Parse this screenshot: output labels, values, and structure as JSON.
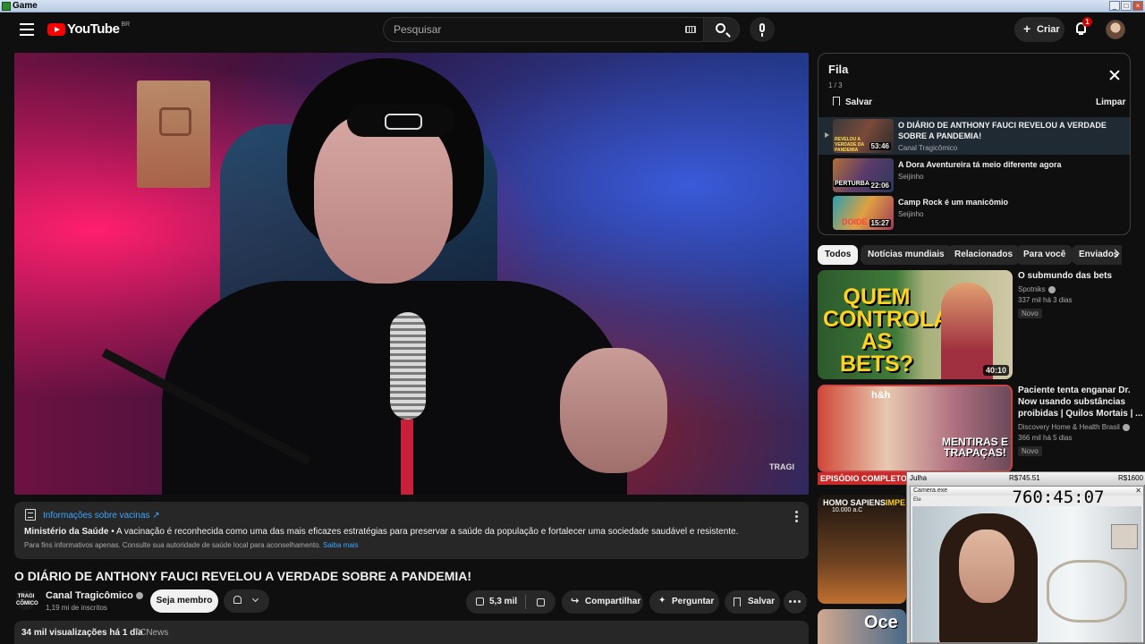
{
  "window": {
    "title": "Game"
  },
  "masthead": {
    "logo_text": "YouTube",
    "region": "BR",
    "search_placeholder": "Pesquisar",
    "create_label": "Criar",
    "notifications": "1"
  },
  "player": {
    "watermark": "TRAGI"
  },
  "info_panel": {
    "title": "Informações sobre vacinas ↗",
    "source": "Ministério da Saúde",
    "text": " • A vacinação é reconhecida como uma das mais eficazes estratégias para preservar a saúde da população e fortalecer uma sociedade saudável e resistente.",
    "footer": "Para fins informativos apenas. Consulte sua autoridade de saúde local para aconselhamento. ",
    "footer_link": "Saiba mais"
  },
  "video": {
    "title": "O DIÁRIO DE ANTHONY FAUCI REVELOU A VERDADE SOBRE A PANDEMIA!",
    "channel": "Canal Tragicômico",
    "channel_avatar": "TRAGI CÔMICO",
    "subscribers": "1,19 mi de inscritos",
    "join_label": "Seja membro",
    "likes": "5,3 mil",
    "share_label": "Compartilhar",
    "ask_label": "Perguntar",
    "save_label": "Salvar",
    "views": "34 mil visualizações  há 1 dia",
    "tag": "TCNews"
  },
  "queue": {
    "title": "Fila",
    "count": "1 / 3",
    "save_label": "Salvar",
    "clear_label": "Limpar",
    "items": [
      {
        "title": "O DIÁRIO DE ANTHONY FAUCI REVELOU A VERDADE SOBRE A PANDEMIA!",
        "channel": "Canal Tragicômico",
        "duration": "53:46",
        "thumb_text": "REVELOU A VERDADE DA PANDEMIA"
      },
      {
        "title": "A Dora Aventureira tá meio diferente agora",
        "channel": "Seijinho",
        "duration": "22:06",
        "thumb_text": "PERTURBA"
      },
      {
        "title": "Camp Rock é um manicômio",
        "channel": "Seijinho",
        "duration": "15:27",
        "thumb_text": "DOIDE"
      }
    ]
  },
  "chips": [
    "Todos",
    "Notícias mundiais",
    "Relacionados",
    "Para você",
    "Enviados"
  ],
  "recommendations": [
    {
      "title": "O submundo das bets",
      "channel": "Spotniks",
      "meta": "337 mil  há 3 dias",
      "badge": "Novo",
      "duration": "40:10",
      "thumb_text": "QUEM CONTROLA AS BETS?"
    },
    {
      "title": "Paciente tenta enganar Dr. Now usando substâncias proibidas | Quilos Mortais | ...",
      "channel": "Discovery Home & Health Brasil",
      "meta": "366 mil  há 5 dias",
      "badge": "Novo",
      "duration": "",
      "thumb_text": "MENTIRAS E TRAPAÇAS!",
      "brand": "h&h",
      "ribbon": "EPISÓDIO COMPLETO"
    },
    {
      "title": "",
      "channel": "",
      "meta": "",
      "badge": "",
      "duration": "",
      "thumb_text": "HOMO SAPIENS",
      "sub_text": "10.000 a.C",
      "extra": "IMPE"
    },
    {
      "title": "",
      "channel": "",
      "meta": "",
      "badge": "",
      "duration": "",
      "thumb_text": "Oce"
    }
  ],
  "overlay": {
    "name": "Julha",
    "money1": "R$745.51",
    "money2": "R$1600",
    "window_title": "Camera.exe",
    "sub": "Ele",
    "timer": "760:45:07"
  }
}
